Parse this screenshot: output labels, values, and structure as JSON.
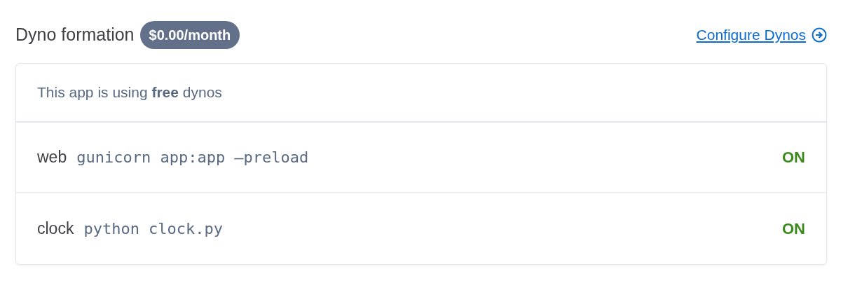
{
  "header": {
    "title": "Dyno formation",
    "cost_badge": "$0.00/month",
    "link": "Configure Dynos"
  },
  "card": {
    "notice": "This app is using **free** dynos",
    "dynos": [
      {
        "name": "web",
        "command": "gunicorn app:app —preload",
        "status": "ON"
      },
      {
        "name": "clock",
        "command": "python clock.py",
        "status": "ON"
      }
    ]
  }
}
